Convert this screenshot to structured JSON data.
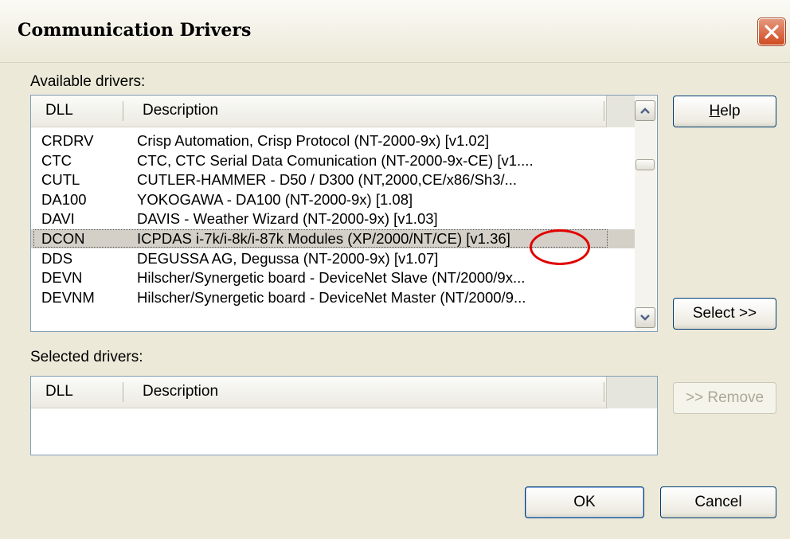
{
  "dialog": {
    "title": "Communication Drivers",
    "close_icon": "close-icon",
    "accent_color": "#cf4b21"
  },
  "available": {
    "label": "Available drivers:",
    "columns": [
      "DLL",
      "Description"
    ],
    "rows": [
      {
        "dll": "CRDRV",
        "description": "Crisp Automation, Crisp Protocol (NT-2000-9x)  [v1.02]"
      },
      {
        "dll": "CTC",
        "description": "CTC,  CTC Serial Data Comunication (NT-2000-9x-CE)  [v1...."
      },
      {
        "dll": "CUTL",
        "description": "CUTLER-HAMMER - D50 / D300 (NT,2000,CE/x86/Sh3/..."
      },
      {
        "dll": "DA100",
        "description": "YOKOGAWA - DA100 (NT-2000-9x) [1.08]"
      },
      {
        "dll": "DAVI",
        "description": "DAVIS - Weather Wizard (NT-2000-9x) [v1.03]"
      },
      {
        "dll": "DCON",
        "description": "ICPDAS i-7k/i-8k/i-87k Modules (XP/2000/NT/CE) [v1.36]",
        "selected": true
      },
      {
        "dll": "DDS",
        "description": "DEGUSSA AG, Degussa (NT-2000-9x) [v1.07]"
      },
      {
        "dll": "DEVN",
        "description": "Hilscher/Synergetic board - DeviceNet Slave (NT/2000/9x..."
      },
      {
        "dll": "DEVNM",
        "description": "Hilscher/Synergetic board - DeviceNet Master (NT/2000/9..."
      }
    ],
    "scroll_up_icon": "chevron-up-icon",
    "scroll_down_icon": "chevron-down-icon"
  },
  "selected": {
    "label": "Selected drivers:",
    "columns": [
      "DLL",
      "Description"
    ],
    "rows": []
  },
  "buttons": {
    "help_prefix": "",
    "help_mnemonic": "H",
    "help_rest": "elp",
    "select": "Select >>",
    "remove": ">> Remove",
    "ok": "OK",
    "cancel": "Cancel"
  }
}
